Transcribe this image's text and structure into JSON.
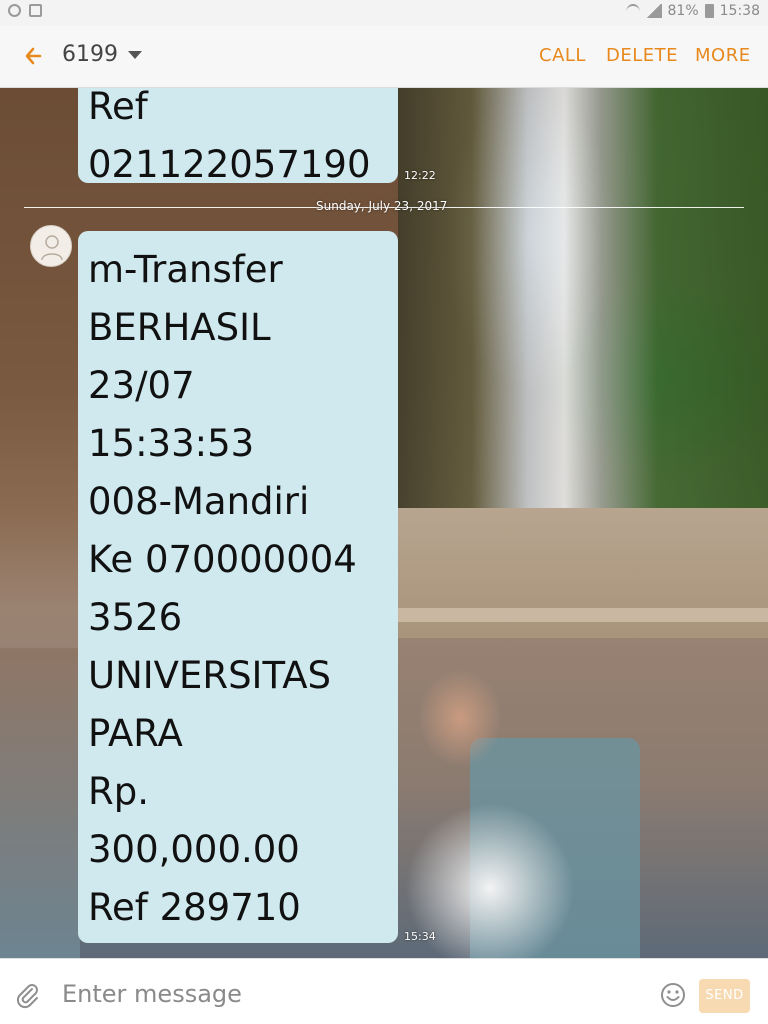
{
  "status": {
    "battery": "81%",
    "time": "15:38"
  },
  "header": {
    "contact": "6199",
    "actions": {
      "call": "CALL",
      "delete": "DELETE",
      "more": "MORE"
    }
  },
  "thread": {
    "top_bubble": {
      "lines": [
        "Ref",
        "021122057190"
      ],
      "time": "12:22"
    },
    "date_label": "Sunday, July 23, 2017",
    "main_bubble": {
      "lines": [
        "m-Transfer",
        "BERHASIL",
        "23/07",
        "15:33:53",
        "008-Mandiri",
        "Ke 070000004",
        "3526",
        "UNIVERSITAS",
        "PARA",
        "Rp.",
        "300,000.00",
        "Ref 289710"
      ],
      "time": "15:34"
    }
  },
  "composer": {
    "placeholder": "Enter message",
    "send_label": "SEND"
  },
  "icons": {
    "back": "back-arrow-icon",
    "dropdown": "chevron-down-icon",
    "attach": "paperclip-icon",
    "emoji": "smiley-icon",
    "avatar": "avatar-icon",
    "whatsapp": "whatsapp-icon",
    "notification": "message-notification-icon",
    "wifi": "wifi-icon",
    "signal": "signal-icon",
    "battery": "battery-icon"
  },
  "colors": {
    "accent": "#e8891d",
    "bubble": "#cfe9ef",
    "send_disabled": "#f7d9b2"
  }
}
